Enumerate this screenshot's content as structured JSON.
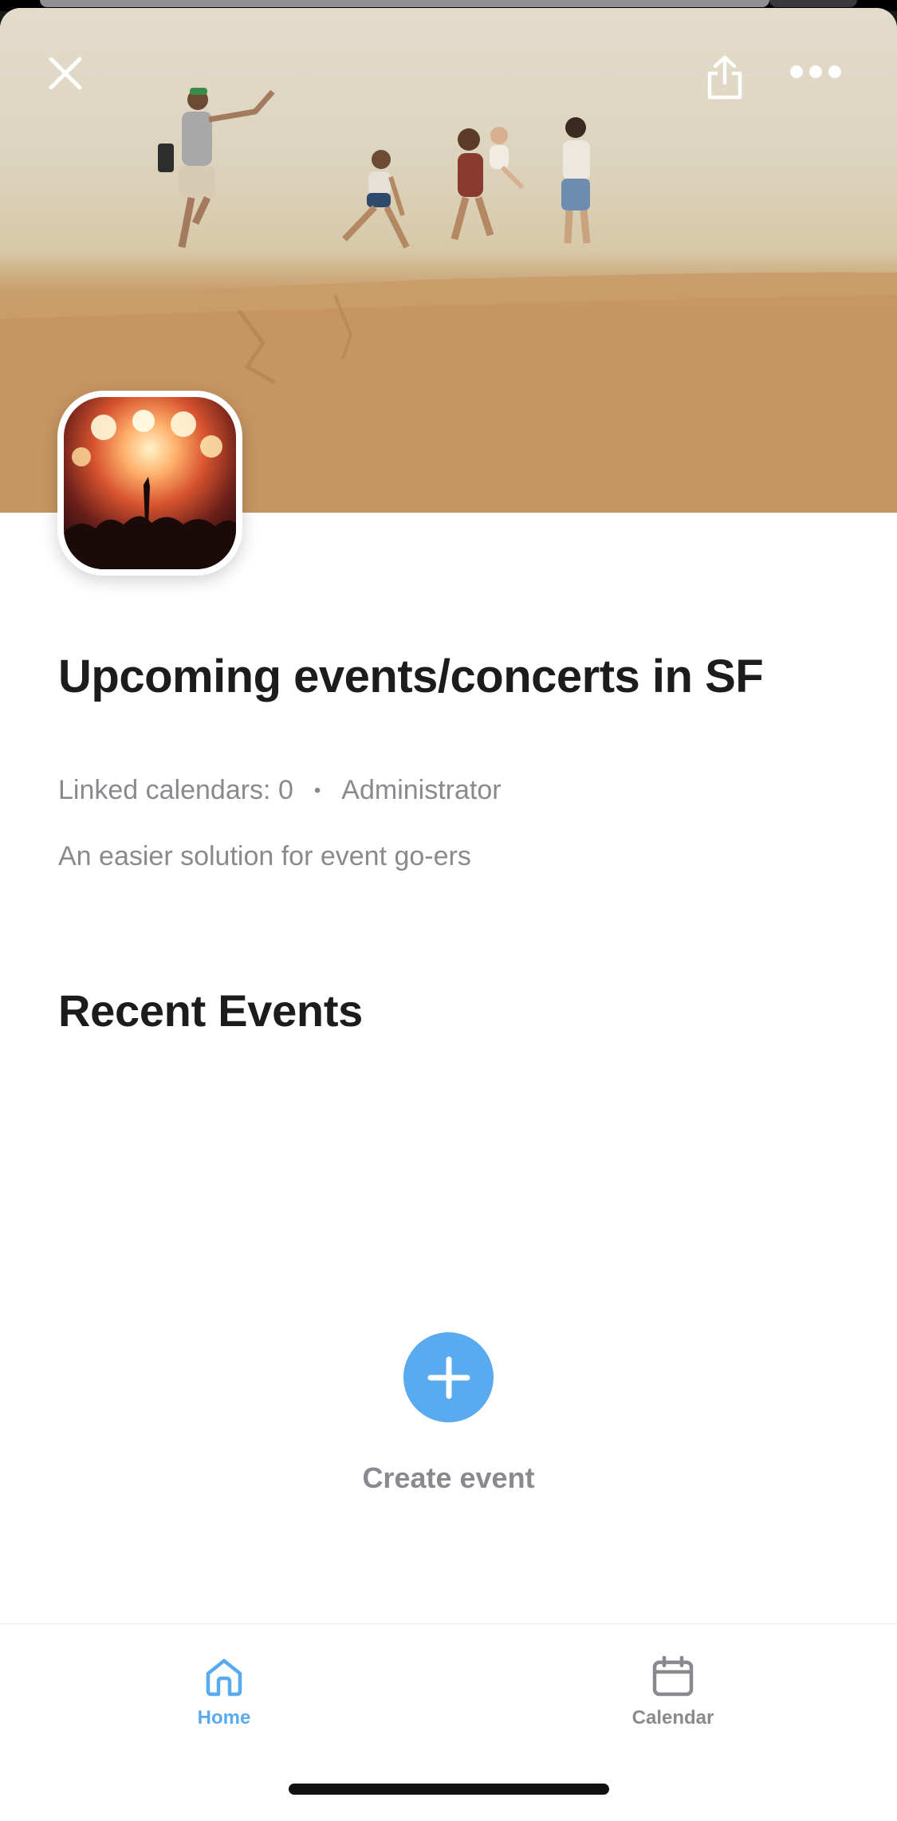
{
  "header": {
    "close_icon": "close-icon",
    "share_icon": "share-icon",
    "more_icon": "more-horizontal-icon"
  },
  "group": {
    "title": "Upcoming events/concerts in SF",
    "linked_calendars": "Linked calendars: 0",
    "separator": "•",
    "role": "Administrator",
    "description": "An easier solution for event go-ers"
  },
  "recent_events": {
    "heading": "Recent Events",
    "create_label": "Create event",
    "create_icon": "plus-icon"
  },
  "tabbar": {
    "tabs": [
      {
        "label": "Home",
        "icon": "home-icon",
        "active": true
      },
      {
        "label": "Calendar",
        "icon": "calendar-icon",
        "active": false
      }
    ]
  },
  "colors": {
    "accent": "#5aaaf0",
    "title_text": "#1c1c1e",
    "secondary_text": "#8a8a8e"
  }
}
